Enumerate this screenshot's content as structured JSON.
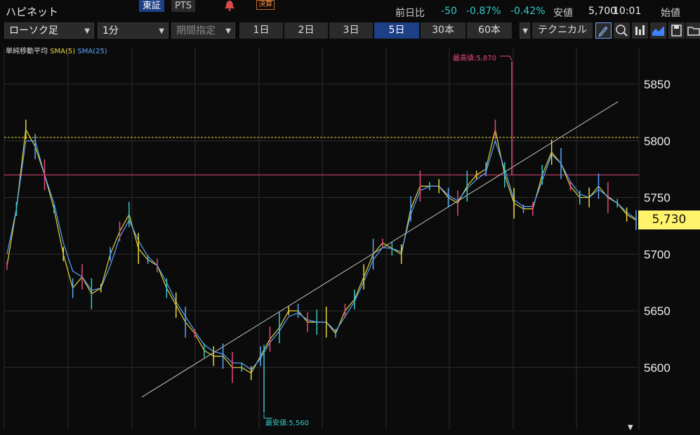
{
  "header": {
    "title": "ハピネット",
    "tabs": [
      {
        "label": "東証",
        "active": true
      },
      {
        "label": "PTS",
        "active": false
      }
    ],
    "kessan": "決算",
    "quote": {
      "label": "前日比",
      "change": "-50",
      "change_pct": "-0.87%",
      "change_pct2": "-0.42%",
      "yasune_label": "安値",
      "price": "5,700",
      "time": "10:01",
      "open_label": "始値"
    }
  },
  "toolbar": {
    "chart_type": "ローソク足",
    "interval": "1分",
    "range": "期間指定",
    "periods": [
      "1日",
      "2日",
      "3日",
      "5日",
      "30本",
      "60本"
    ],
    "active_period": "5日",
    "technical": "テクニカル"
  },
  "chart_data": {
    "type": "line",
    "title": "",
    "legend": {
      "label": "単純移動平均",
      "series": [
        "SMA(5)",
        "SMA(25)"
      ]
    },
    "y_ticks": [
      5850,
      5800,
      5750,
      5700,
      5650,
      5600
    ],
    "ylim": [
      5555,
      5880
    ],
    "current_price": "5,730",
    "high_label": "最高値:5,870",
    "low_label": "最安値:5,560",
    "reference_lines": {
      "dashed_yellow": 5803,
      "solid_red": 5770
    },
    "series": [
      {
        "name": "SMA(5)",
        "color": "#e8d53a",
        "values": [
          5690,
          5740,
          5810,
          5795,
          5770,
          5740,
          5700,
          5670,
          5680,
          5665,
          5670,
          5700,
          5720,
          5735,
          5705,
          5695,
          5690,
          5670,
          5655,
          5640,
          5630,
          5615,
          5610,
          5610,
          5600,
          5600,
          5595,
          5610,
          5625,
          5635,
          5650,
          5650,
          5640,
          5640,
          5640,
          5630,
          5650,
          5660,
          5680,
          5700,
          5710,
          5705,
          5700,
          5740,
          5760,
          5760,
          5760,
          5750,
          5745,
          5760,
          5770,
          5775,
          5810,
          5770,
          5745,
          5740,
          5740,
          5770,
          5790,
          5780,
          5760,
          5750,
          5750,
          5760,
          5750,
          5745,
          5735,
          5730
        ]
      },
      {
        "name": "SMA(25)",
        "color": "#5aa8ff",
        "values": [
          5700,
          5740,
          5800,
          5800,
          5770,
          5745,
          5710,
          5685,
          5680,
          5668,
          5670,
          5690,
          5715,
          5730,
          5712,
          5698,
          5690,
          5675,
          5658,
          5645,
          5632,
          5620,
          5614,
          5612,
          5604,
          5604,
          5598,
          5608,
          5622,
          5632,
          5645,
          5648,
          5642,
          5640,
          5640,
          5632,
          5645,
          5658,
          5676,
          5695,
          5706,
          5705,
          5702,
          5735,
          5756,
          5760,
          5760,
          5752,
          5747,
          5758,
          5766,
          5772,
          5800,
          5775,
          5748,
          5742,
          5742,
          5765,
          5788,
          5780,
          5764,
          5753,
          5750,
          5757,
          5751,
          5745,
          5737,
          5731
        ]
      }
    ]
  }
}
